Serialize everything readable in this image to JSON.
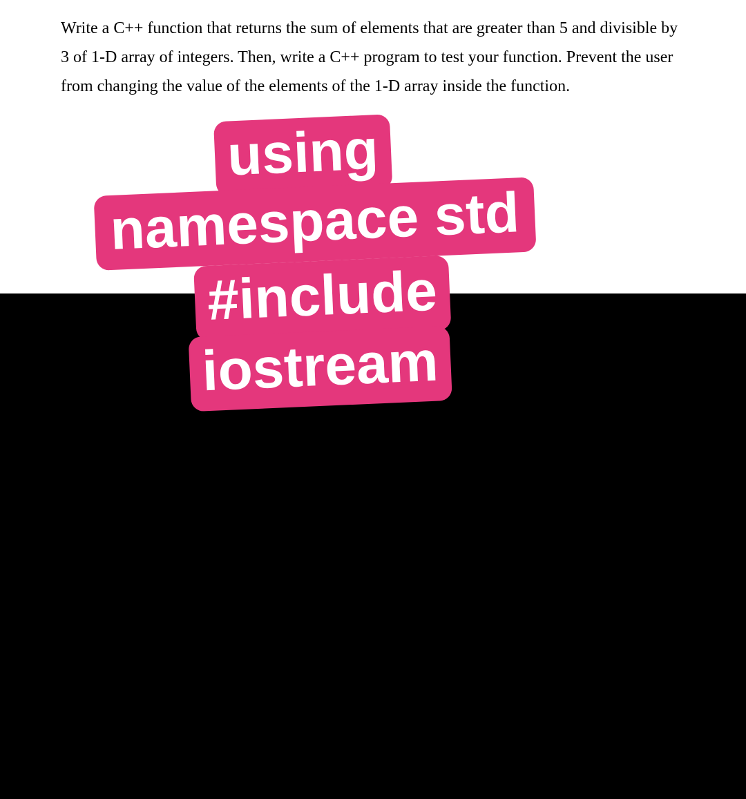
{
  "question": {
    "text": "Write a C++ function that returns the sum of elements that are greater than 5 and divisible by 3 of 1-D array of integers. Then, write a C++ program to test your function. Prevent the user from changing the value of the elements of the 1-D array inside the function."
  },
  "sticker": {
    "line1": "using",
    "line2": "namespace std",
    "line3": "#include",
    "line4": "iostream"
  }
}
